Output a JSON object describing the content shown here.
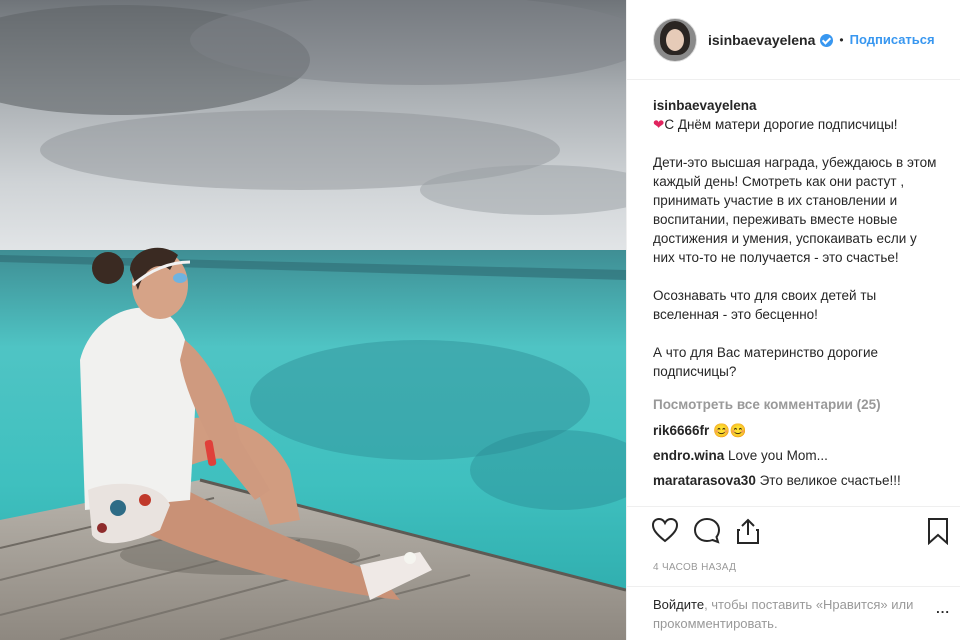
{
  "header": {
    "username": "isinbaevayelena",
    "separator": "•",
    "follow_label": "Подписаться"
  },
  "caption": {
    "username": "isinbaevayelena",
    "heart": "❤",
    "p1": "С Днём матери дорогие подписчицы!",
    "p2": "Дети-это высшая награда, убеждаюсь в этом каждый день! Смотреть как они растут , принимать участие в их становлении и воспитании, переживать вместе новые достижения и умения, успокаивать если у них что-то не получается - это счастье!",
    "p3": "Осознавать что для своих детей ты вселенная - это бесценно!",
    "p4": "А что для Вас материнство дорогие подписчицы?"
  },
  "view_all_comments": "Посмотреть все комментарии (25)",
  "comments": [
    {
      "user": "rik6666fr",
      "text": "😊😊"
    },
    {
      "user": "endro.wina",
      "text": "Love you Mom..."
    },
    {
      "user": "maratarasova30",
      "text": "Это великое счастье!!!"
    }
  ],
  "timestamp": "4 часов назад",
  "login": {
    "link": "Войдите",
    "text": ", чтобы поставить «Нравится» или прокомментировать.",
    "more": "..."
  },
  "icons": [
    "heart-icon",
    "comment-icon",
    "share-icon",
    "bookmark-icon",
    "verified-icon"
  ],
  "colors": {
    "link": "#3897f0",
    "muted": "#999999",
    "verified": "#3897f0"
  }
}
